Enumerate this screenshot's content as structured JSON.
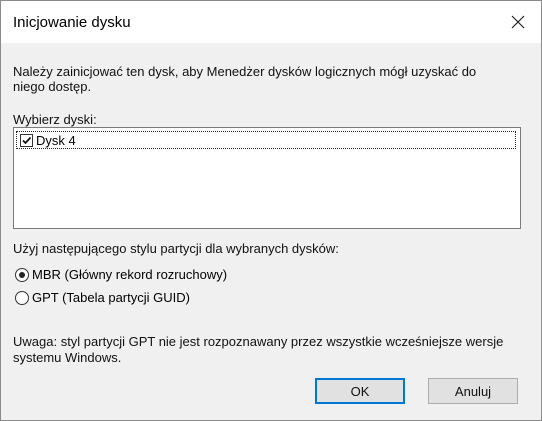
{
  "window": {
    "title": "Inicjowanie dysku",
    "close_icon": "close-icon"
  },
  "description": "Należy zainicjować ten dysk, aby Menedżer dysków logicznych mógł uzyskać do niego dostęp.",
  "disk_select": {
    "label": "Wybierz dyski:",
    "items": [
      {
        "label": "Dysk 4",
        "checked": true
      }
    ]
  },
  "partition_style": {
    "label": "Użyj następującego stylu partycji dla wybranych dysków:",
    "options": [
      {
        "label": "MBR (Główny rekord rozruchowy)",
        "selected": true
      },
      {
        "label": "GPT (Tabela partycji GUID)",
        "selected": false
      }
    ]
  },
  "note": "Uwaga: styl partycji GPT nie jest rozpoznawany przez wszystkie wcześniejsze wersje systemu Windows.",
  "buttons": {
    "ok": "OK",
    "cancel": "Anuluj"
  },
  "colors": {
    "focus_border": "#0078d7",
    "dialog_bg": "#f0f0f0"
  }
}
